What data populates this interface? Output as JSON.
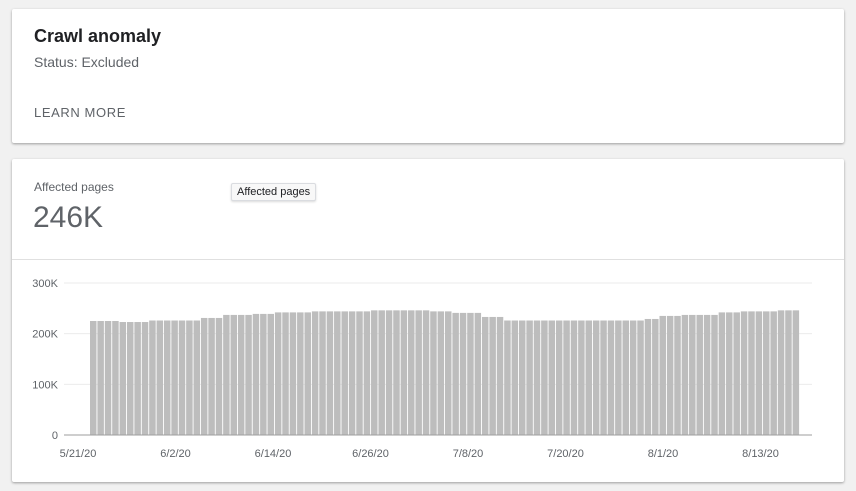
{
  "issue": {
    "title": "Crawl anomaly",
    "status": "Status: Excluded",
    "learn_more": "LEARN MORE"
  },
  "metric": {
    "label": "Affected pages",
    "value": "246K",
    "tooltip": "Affected pages"
  },
  "chart_data": {
    "type": "bar",
    "ylim": [
      0,
      300000
    ],
    "y_ticks": [
      "0",
      "100K",
      "200K",
      "300K"
    ],
    "x_tick_labels": [
      "5/21/20",
      "6/2/20",
      "6/14/20",
      "6/26/20",
      "7/8/20",
      "7/20/20",
      "8/1/20",
      "8/13/20"
    ],
    "bar_color": "#bdbdbd",
    "grid": true,
    "values": [
      225000,
      225000,
      225000,
      225000,
      223000,
      223000,
      223000,
      223000,
      226000,
      226000,
      226000,
      226000,
      226000,
      226000,
      226000,
      231000,
      231000,
      231000,
      237000,
      237000,
      237000,
      237000,
      239000,
      239000,
      239000,
      242000,
      242000,
      242000,
      242000,
      242000,
      244000,
      244000,
      244000,
      244000,
      244000,
      244000,
      244000,
      244000,
      246000,
      246000,
      246000,
      246000,
      246000,
      246000,
      246000,
      246000,
      244000,
      244000,
      244000,
      241000,
      241000,
      241000,
      241000,
      233000,
      233000,
      233000,
      226000,
      226000,
      226000,
      226000,
      226000,
      226000,
      226000,
      226000,
      226000,
      226000,
      226000,
      226000,
      226000,
      226000,
      226000,
      226000,
      226000,
      226000,
      226000,
      229000,
      229000,
      235000,
      235000,
      235000,
      237000,
      237000,
      237000,
      237000,
      237000,
      242000,
      242000,
      242000,
      244000,
      244000,
      244000,
      244000,
      244000,
      246000,
      246000,
      246000
    ]
  }
}
